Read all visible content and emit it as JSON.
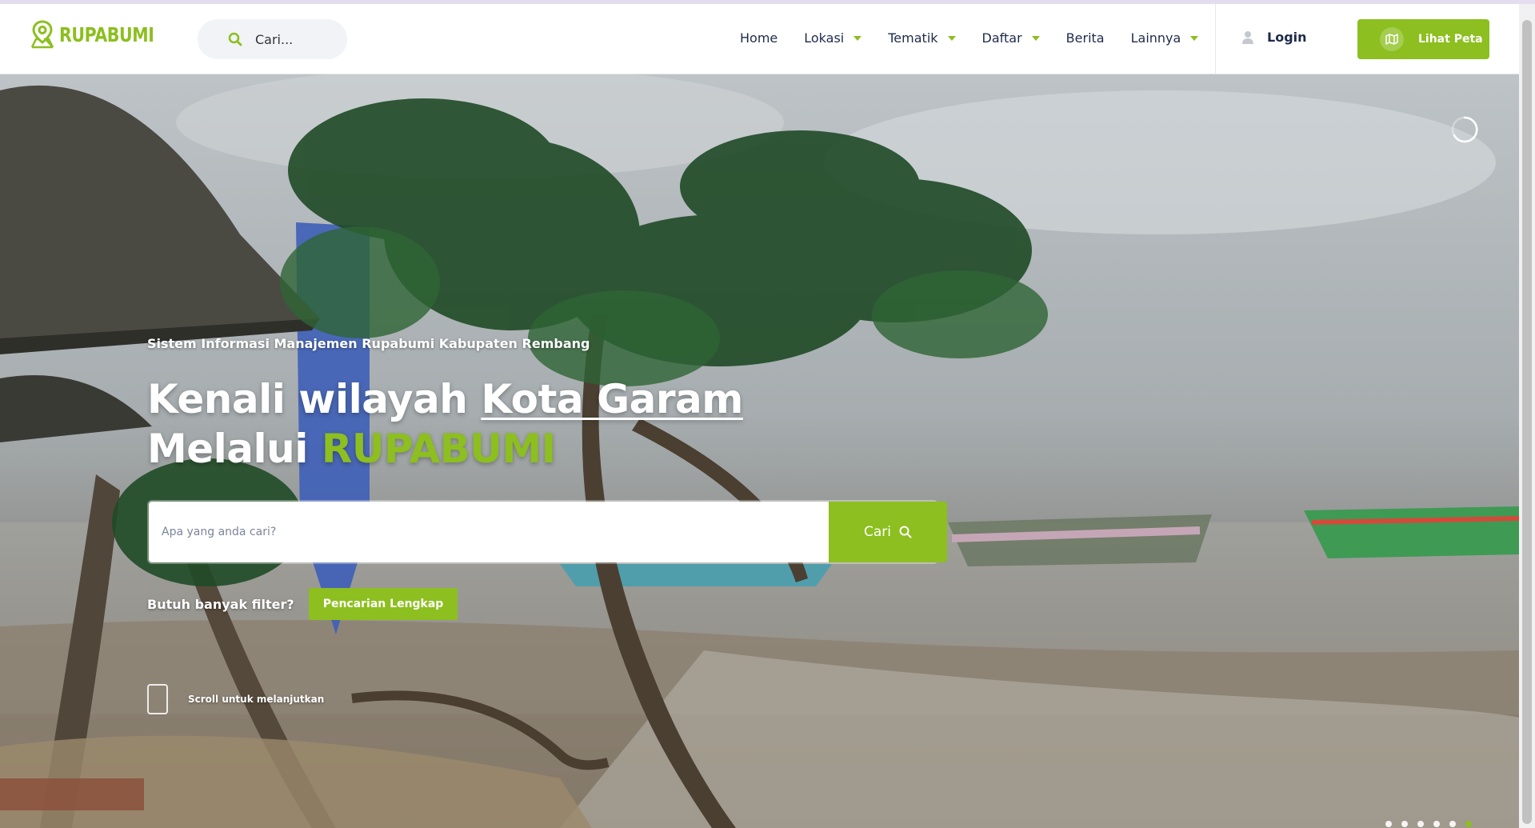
{
  "header": {
    "logo_text": "RUPABUMI",
    "search_placeholder": "Cari...",
    "nav": [
      {
        "label": "Home",
        "dropdown": false
      },
      {
        "label": "Lokasi",
        "dropdown": true
      },
      {
        "label": "Tematik",
        "dropdown": true
      },
      {
        "label": "Daftar",
        "dropdown": true
      },
      {
        "label": "Berita",
        "dropdown": false
      },
      {
        "label": "Lainnya",
        "dropdown": true
      }
    ],
    "login_label": "Login",
    "map_button_label": "Lihat Peta"
  },
  "hero": {
    "subtitle": "Sistem Informasi Manajemen Rupabumi Kabupaten Rembang",
    "headline_line1_prefix": "Kenali wilayah ",
    "headline_line1_link": "Kota Garam",
    "headline_line2_prefix": "Melalui ",
    "headline_line2_accent": "RUPABUMI",
    "search_placeholder": "Apa yang anda cari?",
    "search_button_label": "Cari",
    "filter_question": "Butuh banyak filter?",
    "advanced_search_label": "Pencarian Lengkap",
    "scroll_hint": "Scroll untuk melanjutkan",
    "slide_count": 6,
    "active_slide": 6
  },
  "colors": {
    "accent": "#8cbf1f",
    "nav_text": "#1e2b4a"
  },
  "icons": {
    "logo": "map-pin-logo-icon",
    "header_search": "search-icon",
    "user": "user-icon",
    "map": "map-icon",
    "hero_search": "search-icon",
    "loader": "loading-spinner-icon",
    "mouse": "mouse-scroll-icon"
  }
}
